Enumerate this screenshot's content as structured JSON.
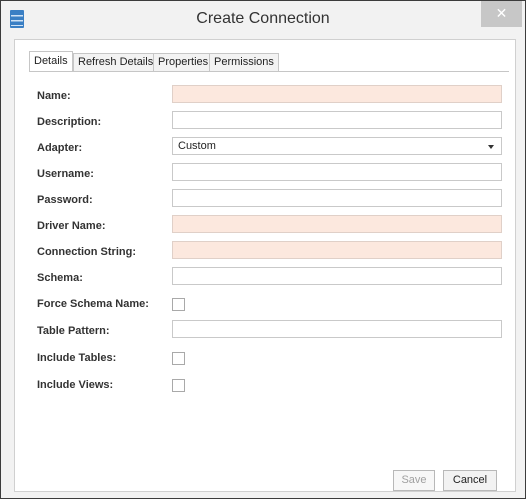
{
  "window": {
    "title": "Create Connection",
    "close_glyph": "✕",
    "app_icon": "database-icon",
    "colors": {
      "accent": "#3a7fc4",
      "required_bg": "#fce8de",
      "close_bg": "#c7c7c7"
    }
  },
  "tabs": [
    {
      "label": "Details",
      "active": true
    },
    {
      "label": "Refresh Details",
      "active": false
    },
    {
      "label": "Properties",
      "active": false
    },
    {
      "label": "Permissions",
      "active": false
    }
  ],
  "form": {
    "name": {
      "label": "Name:",
      "value": ""
    },
    "description": {
      "label": "Description:",
      "value": ""
    },
    "adapter": {
      "label": "Adapter:",
      "value": "Custom"
    },
    "username": {
      "label": "Username:",
      "value": ""
    },
    "password": {
      "label": "Password:",
      "value": ""
    },
    "driver_name": {
      "label": "Driver Name:",
      "value": ""
    },
    "connection_string": {
      "label": "Connection String:",
      "value": ""
    },
    "schema": {
      "label": "Schema:",
      "value": ""
    },
    "force_schema_name": {
      "label": "Force Schema Name:",
      "checked": false
    },
    "table_pattern": {
      "label": "Table Pattern:",
      "value": ""
    },
    "include_tables": {
      "label": "Include Tables:",
      "checked": false
    },
    "include_views": {
      "label": "Include Views:",
      "checked": false
    }
  },
  "footer": {
    "save_label": "Save",
    "cancel_label": "Cancel"
  }
}
